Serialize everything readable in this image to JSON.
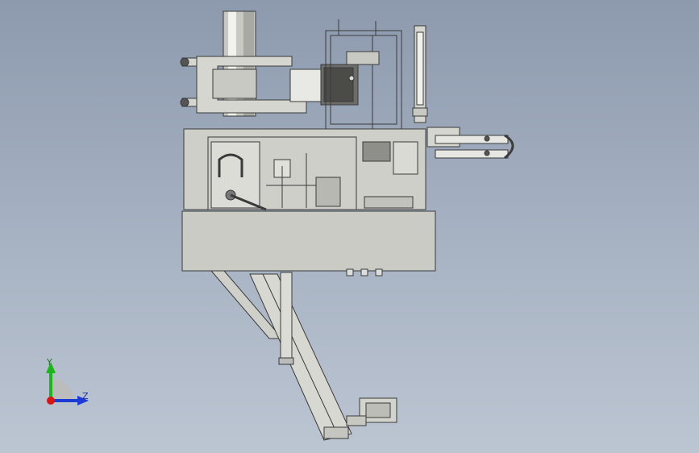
{
  "triad": {
    "y_label": "Y",
    "z_label": "Z",
    "colors": {
      "y": "#1cb51c",
      "z": "#1e3ad6",
      "x": "#d81414"
    }
  },
  "colors": {
    "background_top": "#8d9aae",
    "background_bottom": "#bcc5d2",
    "part_fill": "#d6d6d0",
    "part_stroke": "#3a3a3a"
  }
}
